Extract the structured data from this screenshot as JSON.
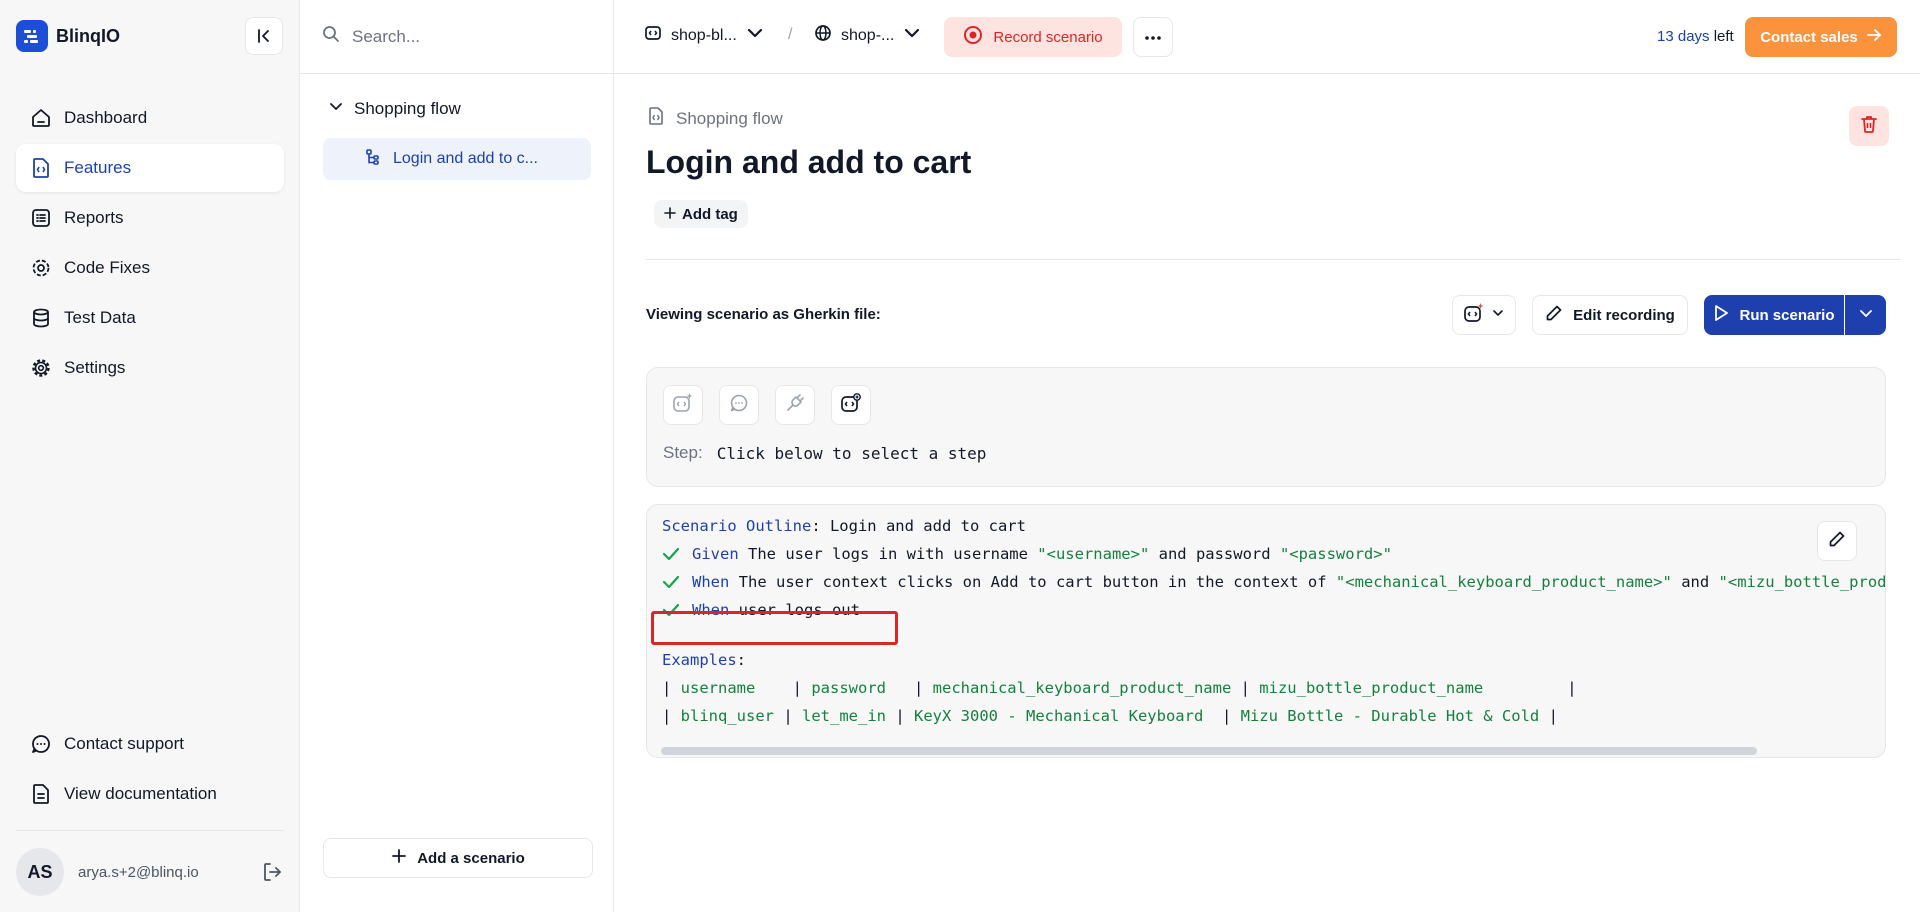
{
  "brand": {
    "name": "BlinqIO",
    "accent": "#1d4ed8"
  },
  "sidebar": {
    "items": [
      {
        "label": "Dashboard",
        "icon": "home-icon"
      },
      {
        "label": "Features",
        "icon": "feature-file-icon",
        "active": true
      },
      {
        "label": "Reports",
        "icon": "list-icon"
      },
      {
        "label": "Code Fixes",
        "icon": "code-fix-gear-icon"
      },
      {
        "label": "Test Data",
        "icon": "database-icon"
      },
      {
        "label": "Settings",
        "icon": "gear-icon"
      }
    ],
    "bottom_items": [
      {
        "label": "Contact support",
        "icon": "chat-bubble-icon"
      },
      {
        "label": "View documentation",
        "icon": "document-icon"
      }
    ],
    "user": {
      "initials": "AS",
      "email": "arya.s+2@blinq.io"
    }
  },
  "tree": {
    "search_placeholder": "Search...",
    "group": "Shopping flow",
    "item": "Login and add to c...",
    "add_scenario": "Add a scenario"
  },
  "topbar": {
    "project": "shop-bl...",
    "environment": "shop-...",
    "separator": "/",
    "record": "Record scenario",
    "trial_days": "13 days",
    "trial_suffix": " left",
    "contact_sales": "Contact sales"
  },
  "main": {
    "breadcrumb": "Shopping flow",
    "title": "Login and add to cart",
    "add_tag": "Add tag",
    "viewing_label": "Viewing scenario as Gherkin file:",
    "edit_recording": "Edit recording",
    "run_scenario": "Run scenario",
    "step_label": "Step:",
    "step_value": "Click below to select a step"
  },
  "gherkin": {
    "header_kw": "Scenario Outline",
    "header_text": ": Login and add to cart",
    "steps": [
      {
        "kw": "Given",
        "parts": [
          {
            "t": " The user logs in with username "
          },
          {
            "s": "\"<username>\""
          },
          {
            "t": " and password "
          },
          {
            "s": "\"<password>\""
          }
        ]
      },
      {
        "kw": "When",
        "parts": [
          {
            "t": " The user context clicks on Add to cart button in the context of "
          },
          {
            "s": "\"<mechanical_keyboard_product_name>\""
          },
          {
            "t": " and "
          },
          {
            "s": "\"<mizu_bottle_product_name>\""
          }
        ]
      },
      {
        "kw": "When",
        "parts": [
          {
            "t": " user logs out"
          }
        ]
      }
    ],
    "examples_kw": "Examples",
    "examples_suffix": ":",
    "table_rows": [
      [
        "username   ",
        "password  ",
        "mechanical_keyboard_product_name",
        "mizu_bottle_product_name        "
      ],
      [
        "blinq_user",
        "let_me_in",
        "KeyX 3000 - Mechanical Keyboard ",
        "Mizu Bottle - Durable Hot & Cold"
      ]
    ]
  },
  "colors": {
    "keyword": "#1e40af",
    "string": "#15803d",
    "check": "#16a34a",
    "highlight_border": "#dc2626",
    "sales_button": "#fb923c",
    "run_button": "#1e40af"
  }
}
